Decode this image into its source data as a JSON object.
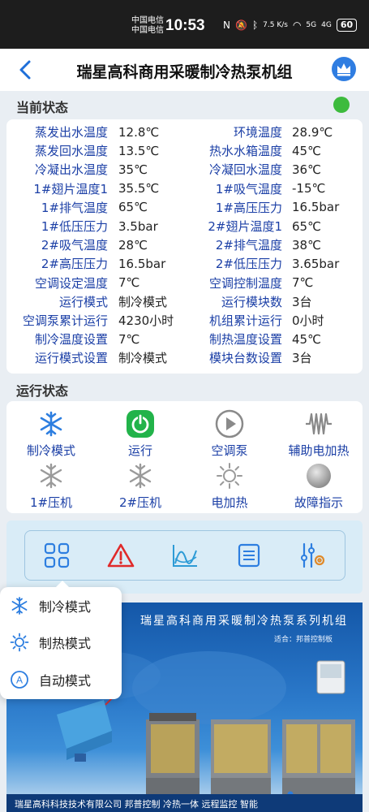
{
  "status_bar": {
    "carrier_1": "中国电信",
    "carrier_2": "中国电信",
    "time": "10:53",
    "net_speed": "7.5 K/s",
    "signal_5g": "5G",
    "signal_4g": "4G",
    "battery": "60"
  },
  "header": {
    "title": "瑞星高科商用采暖制冷热泵机组",
    "back_icon": "chevron-left-icon",
    "crown_icon": "crown-icon"
  },
  "current_status": {
    "label": "当前状态",
    "indicator_color": "#3dbb3d",
    "rows": [
      {
        "l1": "蒸发出水温度",
        "v1": "12.8℃",
        "l2": "环境温度",
        "v2": "28.9℃"
      },
      {
        "l1": "蒸发回水温度",
        "v1": "13.5℃",
        "l2": "热水水箱温度",
        "v2": "45℃"
      },
      {
        "l1": "冷凝出水温度",
        "v1": "35℃",
        "l2": "冷凝回水温度",
        "v2": "36℃"
      },
      {
        "l1": "1#翅片温度1",
        "v1": "35.5℃",
        "l2": "1#吸气温度",
        "v2": "-15℃"
      },
      {
        "l1": "1#排气温度",
        "v1": "65℃",
        "l2": "1#高压压力",
        "v2": "16.5bar"
      },
      {
        "l1": "1#低压压力",
        "v1": "3.5bar",
        "l2": "2#翅片温度1",
        "v2": "65℃"
      },
      {
        "l1": "2#吸气温度",
        "v1": "28℃",
        "l2": "2#排气温度",
        "v2": "38℃"
      },
      {
        "l1": "2#高压压力",
        "v1": "16.5bar",
        "l2": "2#低压压力",
        "v2": "3.65bar"
      },
      {
        "l1": "空调设定温度",
        "v1": "7℃",
        "l2": "空调控制温度",
        "v2": "7℃"
      },
      {
        "l1": "运行模式",
        "v1": "制冷模式",
        "l2": "运行模块数",
        "v2": "3台"
      },
      {
        "l1": "空调泵累计运行",
        "v1": "4230小时",
        "l2": "机组累计运行",
        "v2": "0小时"
      },
      {
        "l1": "制冷温度设置",
        "v1": "7℃",
        "l2": "制热温度设置",
        "v2": "45℃"
      },
      {
        "l1": "运行模式设置",
        "v1": "制冷模式",
        "l2": "模块台数设置",
        "v2": "3台"
      }
    ]
  },
  "run_state": {
    "label": "运行状态",
    "items": [
      {
        "label": "制冷模式",
        "icon": "snowflake-icon",
        "active": true
      },
      {
        "label": "运行",
        "icon": "power-icon",
        "active": true
      },
      {
        "label": "空调泵",
        "icon": "play-icon",
        "active": false
      },
      {
        "label": "辅助电加热",
        "icon": "heater-icon",
        "active": false
      },
      {
        "label": "1#压机",
        "icon": "snowflake-icon",
        "active": false
      },
      {
        "label": "2#压机",
        "icon": "snowflake-icon",
        "active": false
      },
      {
        "label": "电加热",
        "icon": "sun-icon",
        "active": false
      },
      {
        "label": "故障指示",
        "icon": "fault-icon",
        "active": false
      }
    ]
  },
  "toolbar": {
    "buttons": [
      "grid-icon",
      "alarm-icon",
      "chart-icon",
      "list-icon",
      "settings-sliders-icon"
    ]
  },
  "banner": {
    "title": "瑞星高科商用采暖制冷热泵系列机组",
    "subtitle": "适合：邦普控制板",
    "footer": "瑞星高科科技技术有限公司  邦普控制  冷热一体 远程监控 智能"
  },
  "mode_popup": {
    "items": [
      {
        "label": "制冷模式",
        "icon": "snowflake-icon"
      },
      {
        "label": "制热模式",
        "icon": "sun-icon"
      },
      {
        "label": "自动模式",
        "icon": "auto-icon"
      }
    ]
  }
}
